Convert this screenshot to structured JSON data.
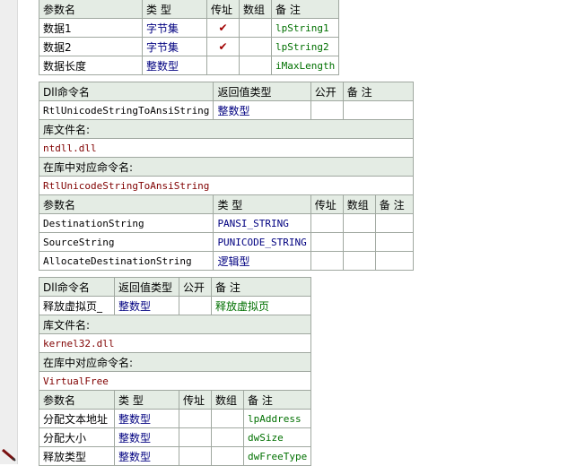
{
  "t1": {
    "headers": [
      "参数名",
      "类 型",
      "传址",
      "数组",
      "备 注"
    ],
    "rows": [
      {
        "name": "数据1",
        "type": "字节集",
        "byref": "✔",
        "array": "",
        "note": "lpString1"
      },
      {
        "name": "数据2",
        "type": "字节集",
        "byref": "✔",
        "array": "",
        "note": "lpString2"
      },
      {
        "name": "数据长度",
        "type": "整数型",
        "byref": "",
        "array": "",
        "note": "iMaxLength"
      }
    ]
  },
  "t2": {
    "headers": [
      "Dll命令名",
      "返回值类型",
      "公开",
      "备 注"
    ],
    "name": "RtlUnicodeStringToAnsiString",
    "ret": "整数型",
    "public": "",
    "note": "",
    "lib_label": "库文件名:",
    "lib": "ntdll.dll",
    "entry_label": "在库中对应命令名:",
    "entry": "RtlUnicodeStringToAnsiString",
    "param_headers": [
      "参数名",
      "类 型",
      "传址",
      "数组",
      "备 注"
    ],
    "params": [
      {
        "name": "DestinationString",
        "type": "PANSI_STRING"
      },
      {
        "name": "SourceString",
        "type": "PUNICODE_STRING"
      },
      {
        "name": "AllocateDestinationString",
        "type": "逻辑型"
      }
    ]
  },
  "t3": {
    "headers": [
      "Dll命令名",
      "返回值类型",
      "公开",
      "备 注"
    ],
    "name": "释放虚拟页_",
    "ret": "整数型",
    "public": "",
    "note": "释放虚拟页",
    "lib_label": "库文件名:",
    "lib": "kernel32.dll",
    "entry_label": "在库中对应命令名:",
    "entry": "VirtualFree",
    "param_headers": [
      "参数名",
      "类 型",
      "传址",
      "数组",
      "备 注"
    ],
    "params": [
      {
        "name": "分配文本地址",
        "type": "整数型",
        "note": "lpAddress"
      },
      {
        "name": "分配大小",
        "type": "整数型",
        "note": "dwSize"
      },
      {
        "name": "释放类型",
        "type": "整数型",
        "note": "dwFreeType"
      }
    ]
  },
  "colors": {
    "type_blue": "#000080",
    "note_green": "#007000",
    "lib_red": "#800000",
    "header_bg": "#e4ece4"
  }
}
